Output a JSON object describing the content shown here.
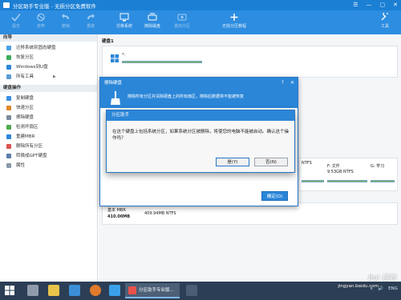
{
  "window": {
    "title": "分区助手专业版 - 无损分区免费软件",
    "controls": [
      "☰",
      "—",
      "▢",
      "✕"
    ]
  },
  "toolbar": {
    "items": [
      {
        "label": "提交",
        "icon": "check-icon"
      },
      {
        "label": "放弃",
        "icon": "undo-icon"
      },
      {
        "label": "撤销",
        "icon": "undo-arrow-icon"
      },
      {
        "label": "重做",
        "icon": "redo-arrow-icon"
      },
      {
        "label": "迁移系统",
        "icon": "migrate-os-icon"
      },
      {
        "label": "擦除磁盘",
        "icon": "wipe-disk-icon"
      },
      {
        "label": "重启分区",
        "icon": "restart-partition-icon"
      },
      {
        "label": "无损分区教程",
        "icon": "tutorial-icon"
      },
      {
        "label": "工具",
        "icon": "tools-icon"
      }
    ]
  },
  "sidebar": {
    "section1": "向导",
    "wizard_items": [
      "迁移系统到固态硬盘",
      "恢复分区",
      "Windows到U盘",
      "所有工具"
    ],
    "section2": "硬盘操作",
    "disk_items": [
      "复制硬盘",
      "快速分区",
      "擦除硬盘",
      "检测坏扇区",
      "重建MBR",
      "删除所有分区",
      "转换成GPT硬盘",
      "属性"
    ]
  },
  "main": {
    "disk_label": "硬盘1",
    "partitions": [
      {
        "name": "*:",
        "info": ""
      },
      {
        "name": "F: 文件",
        "info": "9.53GB NTFS"
      },
      {
        "name": "G: 学习",
        "info": ""
      }
    ],
    "ntfs": "NTFS",
    "bottom_disk": {
      "label": "基本 MBR",
      "size": "410.00MB",
      "info": "409.94MB NTFS"
    }
  },
  "wipe_dialog": {
    "title": "擦除硬盘",
    "header_text": "擦除所有分区并清除硬盘上的所有扇区，擦除后数据将不能被恢复",
    "ok_label": "确定(O)",
    "help": "?",
    "close": "✕"
  },
  "confirm_dialog": {
    "title": "分区助手",
    "message": "在这个硬盘上包括系统分区，如果系统分区被删除，将使您的电脑不能被启动。确认这个操作吗？",
    "yes_label": "是(Y)",
    "no_label": "否(N)"
  },
  "taskbar": {
    "app_label": "分区助手专业版...",
    "tray": [
      "∧",
      "🔊",
      "ENG"
    ]
  },
  "watermark": {
    "text": "Bai 经验",
    "url": "jingyan.baidu.com"
  }
}
